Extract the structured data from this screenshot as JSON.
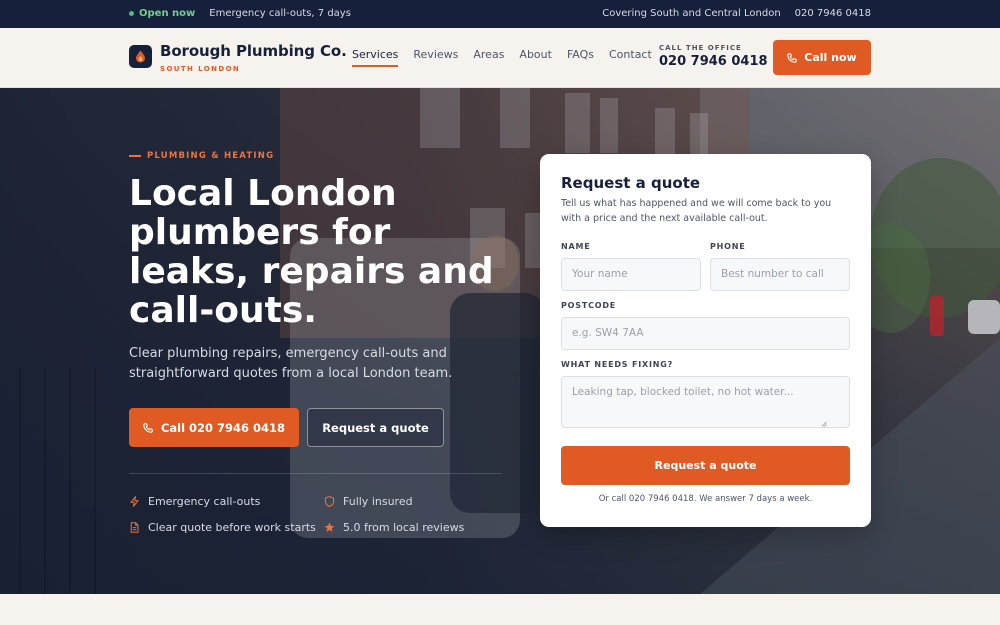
{
  "topbar": {
    "open_label": "Open now",
    "callouts": "Emergency call-outs, 7 days",
    "coverage": "Covering South and Central London",
    "phone": "020 7946 0418"
  },
  "header": {
    "brand_name": "Borough Plumbing Co.",
    "brand_sub": "SOUTH LONDON",
    "nav": [
      "Services",
      "Reviews",
      "Areas",
      "About",
      "FAQs",
      "Contact"
    ],
    "active_nav": "Services",
    "office_label": "CALL THE OFFICE",
    "office_number": "020 7946 0418",
    "call_button": "Call now"
  },
  "hero": {
    "kicker": "PLUMBING & HEATING",
    "headline": "Local London plumbers for leaks, repairs and call-outs.",
    "lead": "Clear plumbing repairs, emergency call-outs and straightforward quotes from a local London team.",
    "call_button": "Call 020 7946 0418",
    "quote_button": "Request a quote",
    "features": [
      {
        "icon": "bolt-icon",
        "label": "Emergency call-outs"
      },
      {
        "icon": "shield-icon",
        "label": "Fully insured"
      },
      {
        "icon": "document-icon",
        "label": "Clear quote before work starts"
      },
      {
        "icon": "star-icon",
        "label": "5.0 from local reviews"
      }
    ]
  },
  "quote_form": {
    "title": "Request a quote",
    "description": "Tell us what has happened and we will come back to you with a price and the next available call-out.",
    "name_label": "NAME",
    "name_placeholder": "Your name",
    "phone_label": "PHONE",
    "phone_placeholder": "Best number to call",
    "postcode_label": "POSTCODE",
    "postcode_placeholder": "e.g. SW4 7AA",
    "issue_label": "WHAT NEEDS FIXING?",
    "issue_placeholder": "Leaking tap, blocked toilet, no hot water...",
    "submit": "Request a quote",
    "note": "Or call 020 7946 0418. We answer 7 days a week."
  },
  "colors": {
    "accent": "#e05a24",
    "navy": "#17203a",
    "open_green": "#4bbf73"
  }
}
